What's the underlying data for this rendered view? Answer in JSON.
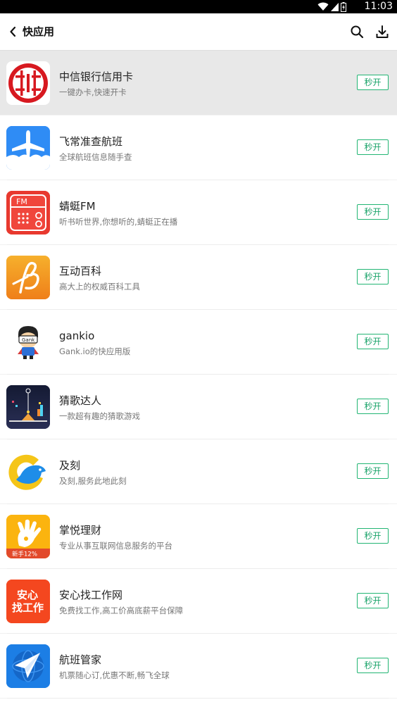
{
  "status_bar": {
    "time": "11:03"
  },
  "toolbar": {
    "title": "快应用"
  },
  "apps": [
    {
      "name": "中信银行信用卡",
      "desc": "一键办卡,快速开卡",
      "button": "秒开",
      "icon": "citic-bank-icon"
    },
    {
      "name": "飞常准查航班",
      "desc": "全球航班信息随手查",
      "button": "秒开",
      "icon": "airplane-icon"
    },
    {
      "name": "蜻蜓FM",
      "desc": "听书听世界,你想听的,蜻蜓正在播",
      "button": "秒开",
      "icon": "radio-icon",
      "icon_text": "FM"
    },
    {
      "name": "互动百科",
      "desc": "高大上的权威百科工具",
      "button": "秒开",
      "icon": "baike-icon"
    },
    {
      "name": "gankio",
      "desc": "Gank.io的快应用版",
      "button": "秒开",
      "icon": "gank-avatar-icon",
      "icon_text": "Gank"
    },
    {
      "name": "猜歌达人",
      "desc": "一款超有趣的猜歌游戏",
      "button": "秒开",
      "icon": "music-game-icon"
    },
    {
      "name": "及刻",
      "desc": "及刻,服务此地此刻",
      "button": "秒开",
      "icon": "bird-icon"
    },
    {
      "name": "掌悦理财",
      "desc": "专业从事互联网信息服务的平台",
      "button": "秒开",
      "icon": "hand-icon",
      "icon_text": "新手12%"
    },
    {
      "name": "安心找工作网",
      "desc": "免费找工作,高工价高底薪平台保障",
      "button": "秒开",
      "icon": "job-icon",
      "icon_text_1": "安心",
      "icon_text_2": "找工作"
    },
    {
      "name": "航班管家",
      "desc": "机票随心订,优惠不断,畅飞全球",
      "button": "秒开",
      "icon": "globe-plane-icon"
    }
  ],
  "colors": {
    "accent": "#22b573",
    "highlight_row": "#e8e8e8"
  }
}
